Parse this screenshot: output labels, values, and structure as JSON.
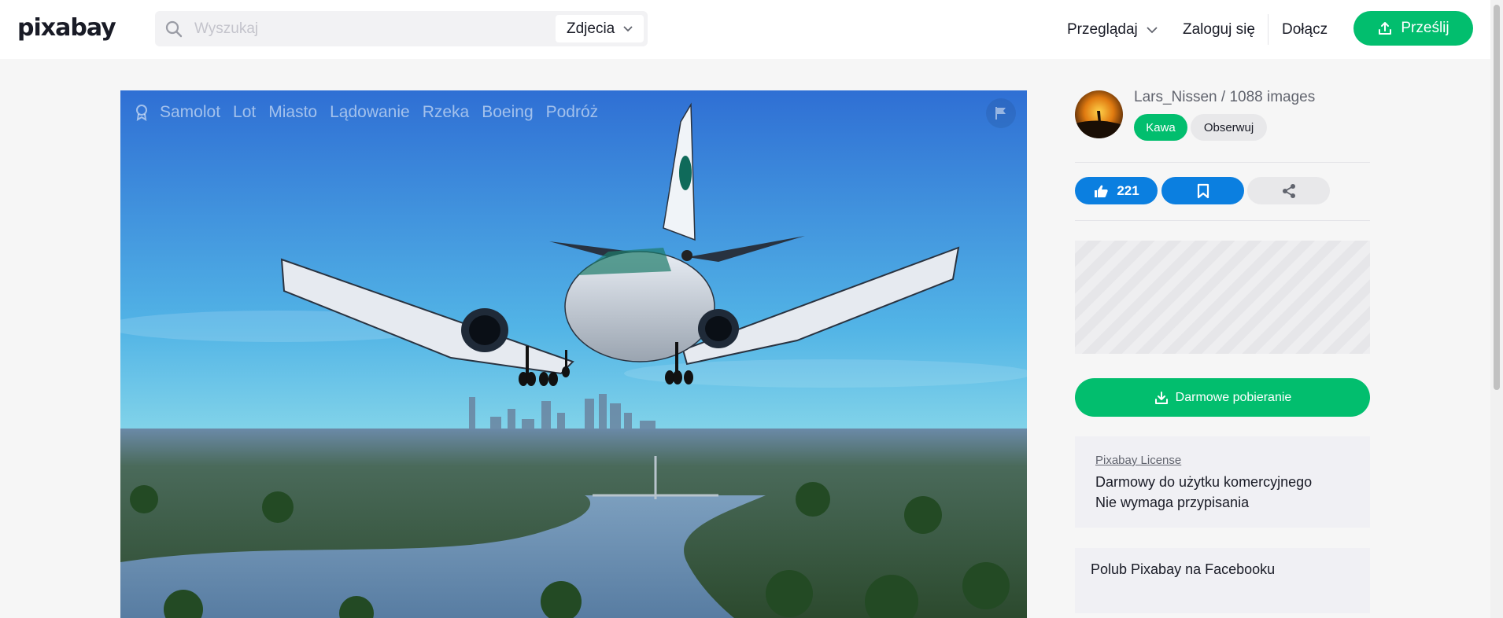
{
  "header": {
    "logo": "pixabay",
    "search": {
      "placeholder": "Wyszukaj",
      "value": ""
    },
    "type_select": "Zdjecia",
    "nav": {
      "browse": "Przeglądaj",
      "login": "Zaloguj się",
      "join": "Dołącz",
      "upload": "Prześlij"
    }
  },
  "photo": {
    "tags": [
      "Samolot",
      "Lot",
      "Miasto",
      "Lądowanie",
      "Rzeka",
      "Boeing",
      "Podróż"
    ]
  },
  "author": {
    "name": "Lars_Nissen",
    "separator": " / ",
    "images": "1088 images",
    "coffee": "Kawa",
    "follow": "Obserwuj"
  },
  "actions": {
    "likes": "221"
  },
  "download": {
    "label": "Darmowe pobieranie"
  },
  "license": {
    "link": "Pixabay License",
    "line1": "Darmowy do użytku komercyjnego",
    "line2": "Nie wymaga przypisania"
  },
  "facebook": {
    "text": "Polub Pixabay na Facebooku"
  },
  "colors": {
    "brand_green": "#02be6e",
    "action_blue": "#0b7fe0"
  }
}
